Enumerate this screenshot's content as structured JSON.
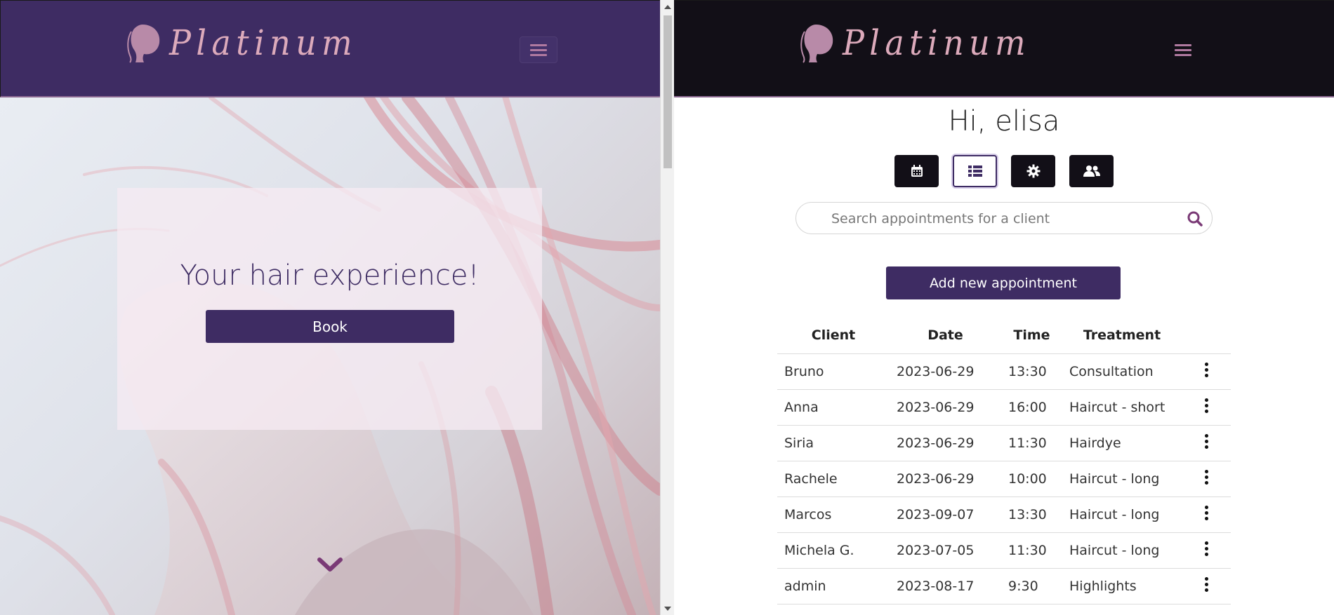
{
  "left": {
    "brand": "Platinum",
    "hero_title": "Your hair experience!",
    "book_label": "Book"
  },
  "right": {
    "brand": "Platinum",
    "greeting": "Hi, elisa",
    "toolbar": [
      "calendar-icon",
      "list-icon",
      "gear-icon",
      "users-icon"
    ],
    "search_placeholder": "Search appointments for a client",
    "add_label": "Add new appointment",
    "table": {
      "headers": [
        "Client",
        "Date",
        "Time",
        "Treatment"
      ],
      "rows": [
        {
          "client": "Bruno",
          "date": "2023-06-29",
          "time": "13:30",
          "treatment": "Consultation"
        },
        {
          "client": "Anna",
          "date": "2023-06-29",
          "time": "16:00",
          "treatment": "Haircut - short"
        },
        {
          "client": "Siria",
          "date": "2023-06-29",
          "time": "11:30",
          "treatment": "Hairdye"
        },
        {
          "client": "Rachele",
          "date": "2023-06-29",
          "time": "10:00",
          "treatment": "Haircut - long"
        },
        {
          "client": "Marcos",
          "date": "2023-09-07",
          "time": "13:30",
          "treatment": "Haircut - long"
        },
        {
          "client": "Michela G.",
          "date": "2023-07-05",
          "time": "11:30",
          "treatment": "Haircut - long"
        },
        {
          "client": "admin",
          "date": "2023-08-17",
          "time": "9:30",
          "treatment": "Highlights"
        }
      ]
    }
  },
  "colors": {
    "brand_purple": "#3e2c63",
    "dark_nav": "#120f17",
    "logo_pink": "#dcaabb",
    "accent_mauve": "#8d6a93"
  }
}
